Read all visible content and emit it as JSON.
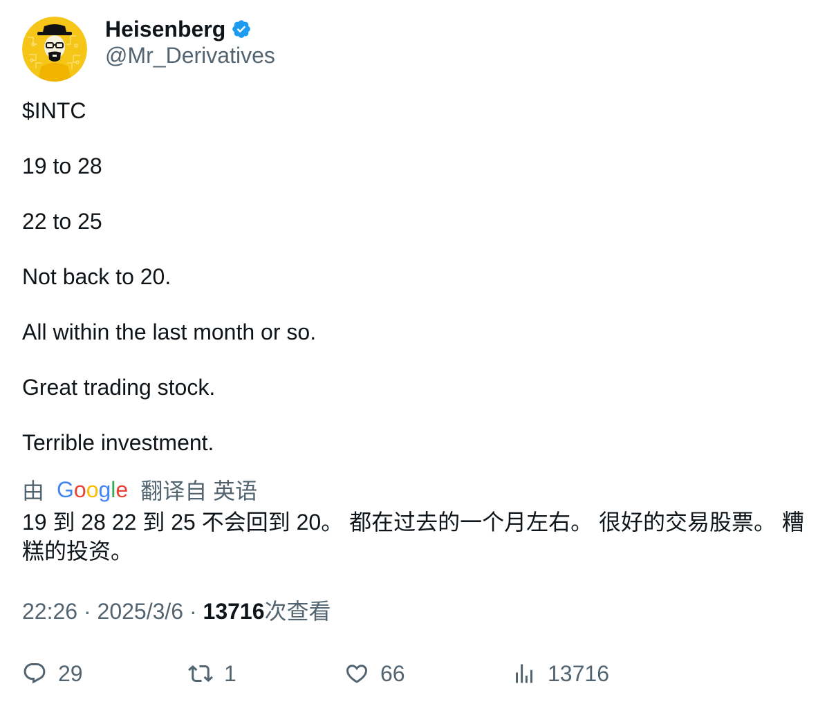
{
  "author": {
    "display_name": "Heisenberg",
    "handle": "@Mr_Derivatives",
    "verified_icon": "verified-badge-icon",
    "avatar_icon": "heisenberg-avatar-icon"
  },
  "tweet": {
    "paragraphs": [
      "$INTC",
      "19 to 28",
      "22 to 25",
      "Not back to 20.",
      "All within the last month or so.",
      "Great trading stock.",
      "Terrible investment."
    ]
  },
  "translation": {
    "by_label": "由",
    "google_letters": [
      "G",
      "o",
      "o",
      "g",
      "l",
      "e"
    ],
    "google_colors": [
      "#4285F4",
      "#EA4335",
      "#FBBC05",
      "#4285F4",
      "#34A853",
      "#EA4335"
    ],
    "from_label": "翻译自 英语",
    "text": "19 到 28 22 到 25 不会回到 20。 都在过去的一个月左右。 很好的交易股票。 糟糕的投资。"
  },
  "meta": {
    "time": "22:26",
    "separator": " · ",
    "date": "2025/3/6",
    "views_count": "13716",
    "views_label": "次查看"
  },
  "actions": {
    "replies": "29",
    "retweets": "1",
    "likes": "66",
    "views": "13716"
  },
  "colors": {
    "text_primary": "#0f1419",
    "text_secondary": "#536471",
    "verified_blue": "#1d9bf0",
    "avatar_yellow": "#f5c518"
  }
}
